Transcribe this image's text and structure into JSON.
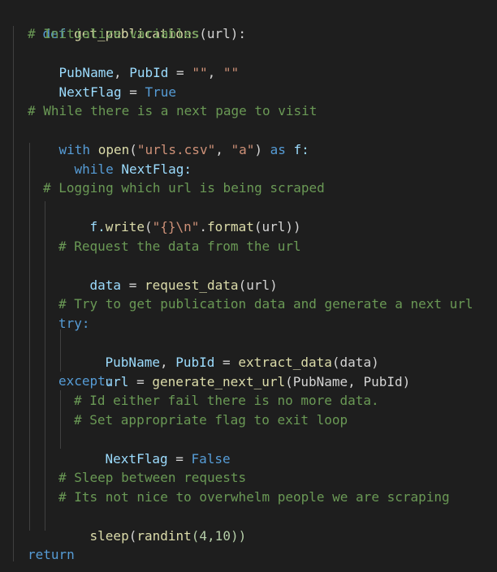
{
  "editor": {
    "theme_colors": {
      "background": "#1e1e1e",
      "keyword": "#569cd6",
      "function": "#dcdcaa",
      "string": "#ce9178",
      "comment": "#6a9955",
      "variable": "#9cdcfe",
      "text": "#d4d4d4",
      "number": "#b5cea8",
      "indent_guide": "#404040"
    },
    "code": {
      "l1": {
        "kw": "def",
        "fn": "get_publications",
        "rest": "(url):"
      },
      "l2": "# Initialize variables",
      "l3": {
        "a": "PubName",
        "b": ", ",
        "c": "PubId",
        "d": " = ",
        "e": "\"\"",
        "f": ", ",
        "g": "\"\""
      },
      "l4": {
        "a": "NextFlag",
        "b": " = ",
        "c": "True"
      },
      "l5": "# While there is a next page to visit",
      "l6": {
        "kw": "with",
        "sp": " ",
        "fn": "open",
        "p1": "(",
        "s1": "\"urls.csv\"",
        "c": ", ",
        "s2": "\"a\"",
        "p2": ") ",
        "as": "as",
        "f": " f:"
      },
      "l7": {
        "kw": "while",
        "var": " NextFlag:"
      },
      "l8": "# Logging which url is being scraped",
      "l9": {
        "a": "f.",
        "fn": "write",
        "p1": "(",
        "s": "\"{}\\n\"",
        "b": ".",
        "fn2": "format",
        "c": "(url))"
      },
      "l10": "# Request the data from the url",
      "l11": {
        "a": "data",
        "b": " = ",
        "fn": "request_data",
        "c": "(url)"
      },
      "l12": "# Try to get publication data and generate a next url",
      "l13": "try:",
      "l14": {
        "a": "PubName",
        "b": ", ",
        "c": "PubId",
        "d": " = ",
        "fn": "extract_data",
        "e": "(data)"
      },
      "l15": {
        "a": "url",
        "b": " = ",
        "fn": "generate_next_url",
        "c": "(PubName, PubId)"
      },
      "l16": "except:",
      "l17": "# Id either fail there is no more data.",
      "l18": "# Set appropriate flag to exit loop",
      "l19": {
        "a": "NextFlag",
        "b": " = ",
        "c": "False"
      },
      "l20": "# Sleep between requests",
      "l21": "# Its not nice to overwhelm people we are scraping",
      "l22": {
        "fn": "sleep",
        "a": "(",
        "fn2": "randint",
        "b": "(4,10))"
      },
      "l23": "return"
    }
  }
}
